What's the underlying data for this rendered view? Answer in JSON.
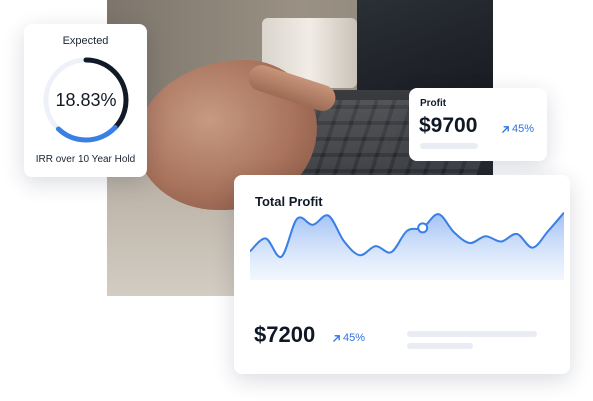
{
  "irr_card": {
    "title": "Expected",
    "value": "18.83%",
    "subtitle": "IRR over 10 Year Hold",
    "progress_fraction": 0.62
  },
  "profit_card": {
    "label": "Profit",
    "value": "$9700",
    "change": "45%",
    "change_icon": "arrow-up-right-icon"
  },
  "total_card": {
    "title": "Total Profit",
    "value": "$7200",
    "change": "45%",
    "change_icon": "arrow-up-right-icon"
  },
  "colors": {
    "accent_blue": "#2f73e0",
    "ring_dark": "#121a28",
    "ring_track": "#eef2f8",
    "line_blue": "#3a7fe6",
    "area_fill": "#cfe0fb"
  },
  "chart_data": {
    "type": "area",
    "x": [
      0,
      1,
      2,
      3,
      4,
      5,
      6,
      7,
      8,
      9,
      10,
      11,
      12,
      13,
      14,
      15,
      16,
      17,
      18,
      19,
      20
    ],
    "values": [
      35,
      52,
      28,
      78,
      70,
      82,
      48,
      30,
      42,
      34,
      62,
      66,
      84,
      60,
      46,
      55,
      48,
      58,
      40,
      62,
      86
    ],
    "highlight_index": 11,
    "ylim": [
      0,
      100
    ],
    "grid": false,
    "title": "",
    "xlabel": "",
    "ylabel": ""
  }
}
